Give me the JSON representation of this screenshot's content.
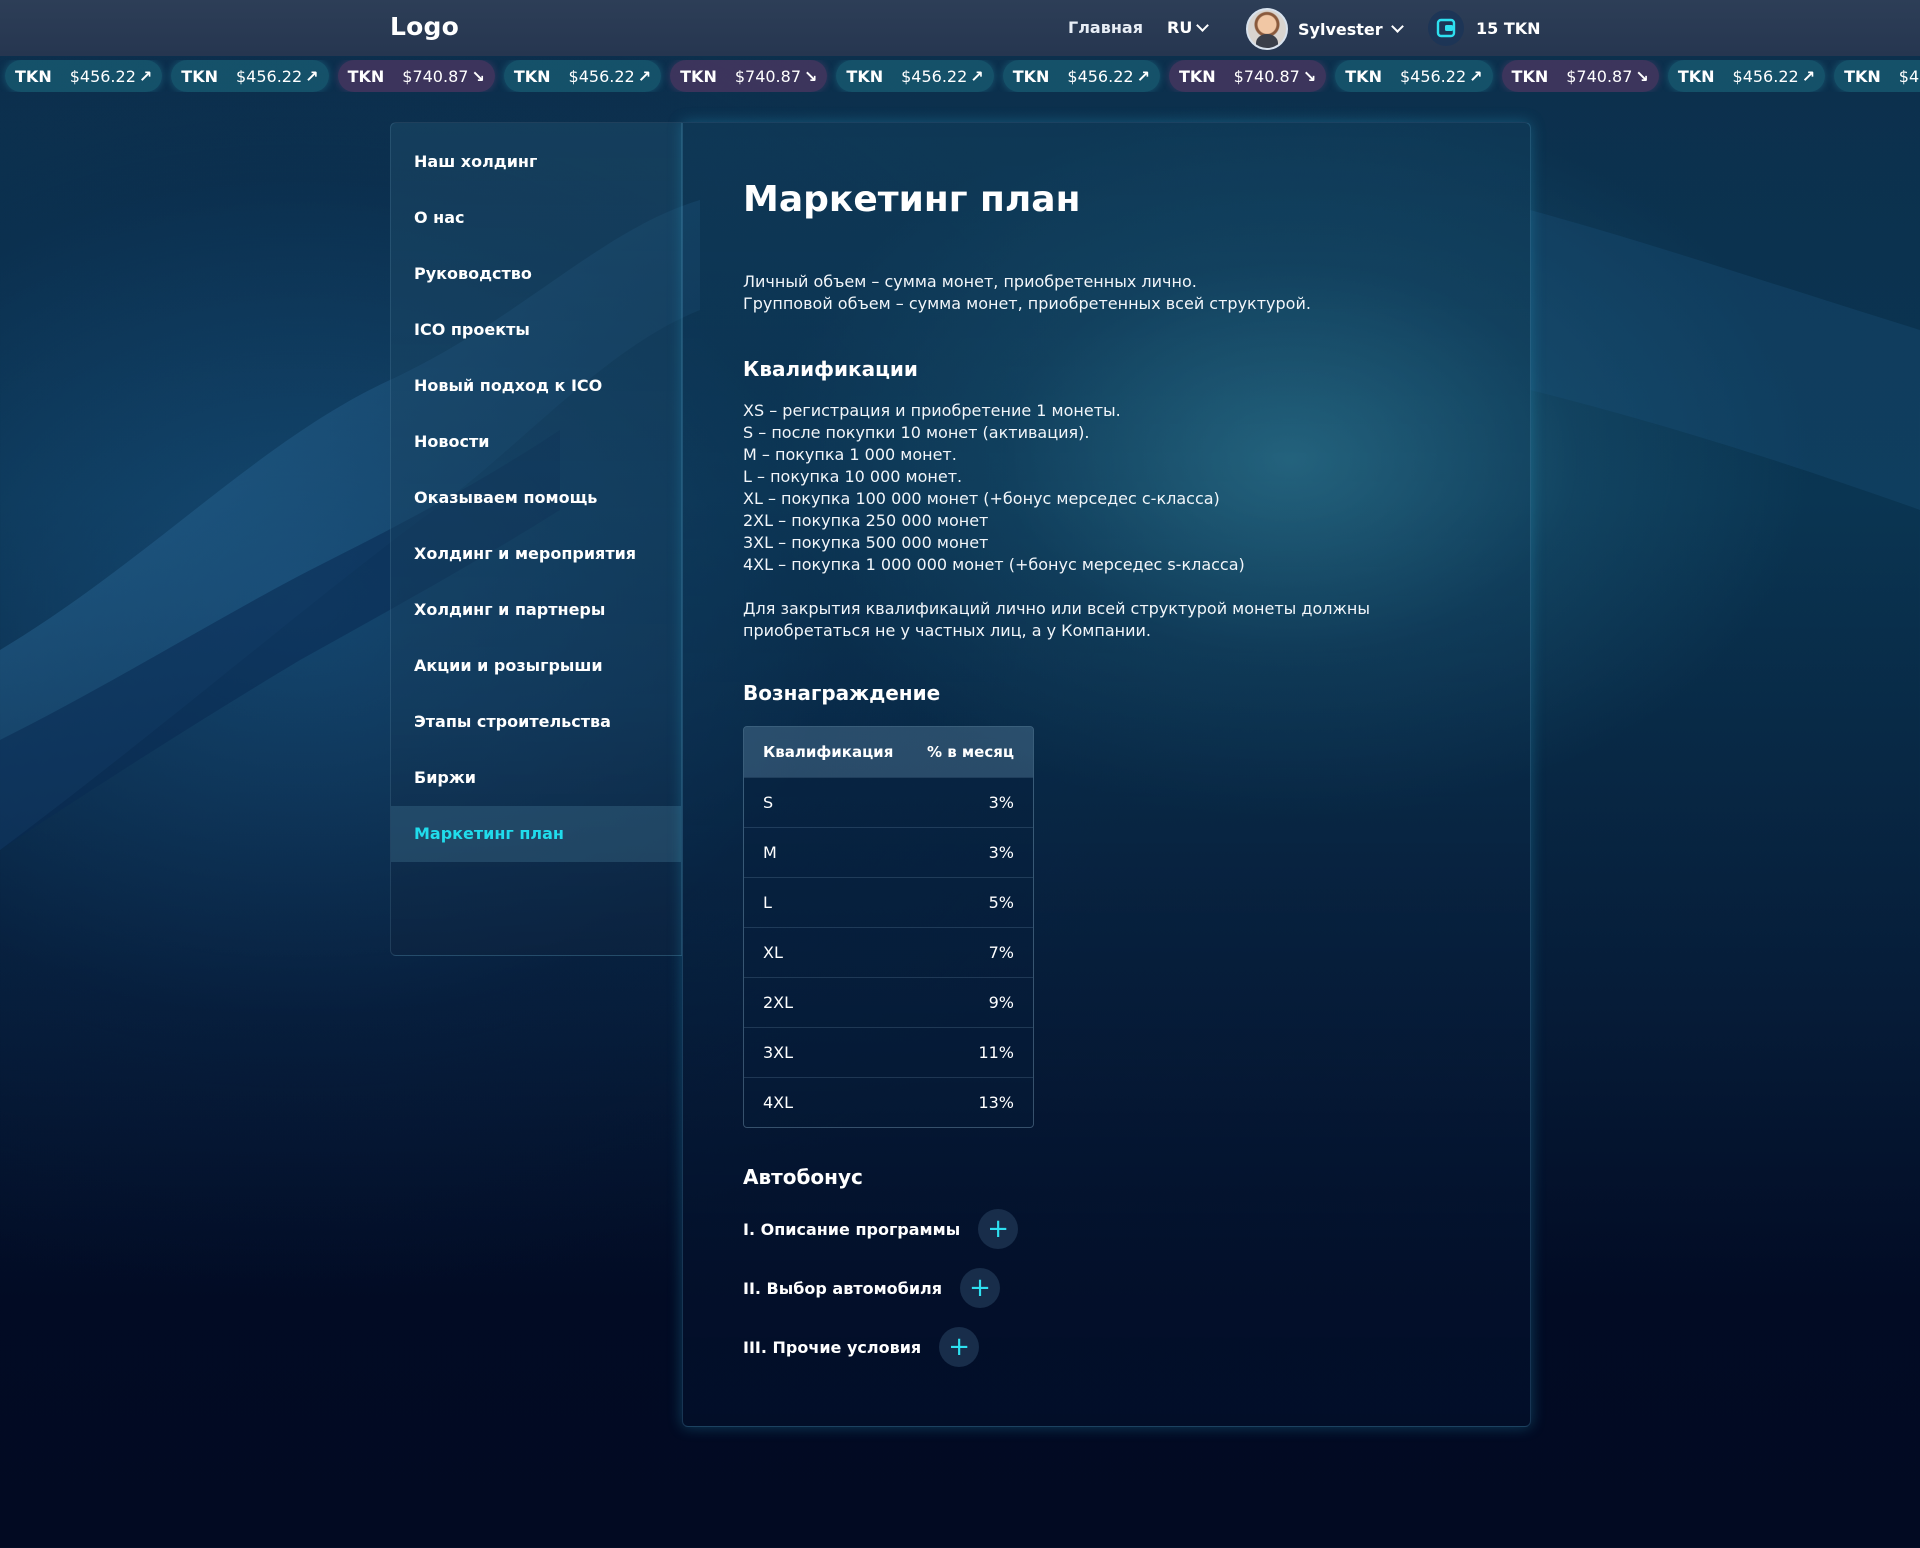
{
  "header": {
    "logo": "Logo",
    "nav_home": "Главная",
    "language": "RU",
    "user_name": "Sylvester",
    "wallet_balance": "15 TKN"
  },
  "ticker": [
    {
      "symbol": "TKN",
      "price": "$456.22",
      "trend": "up"
    },
    {
      "symbol": "TKN",
      "price": "$456.22",
      "trend": "up"
    },
    {
      "symbol": "TKN",
      "price": "$740.87",
      "trend": "down"
    },
    {
      "symbol": "TKN",
      "price": "$456.22",
      "trend": "up"
    },
    {
      "symbol": "TKN",
      "price": "$740.87",
      "trend": "down"
    },
    {
      "symbol": "TKN",
      "price": "$456.22",
      "trend": "up"
    },
    {
      "symbol": "TKN",
      "price": "$456.22",
      "trend": "up"
    },
    {
      "symbol": "TKN",
      "price": "$740.87",
      "trend": "down"
    },
    {
      "symbol": "TKN",
      "price": "$456.22",
      "trend": "up"
    },
    {
      "symbol": "TKN",
      "price": "$740.87",
      "trend": "down"
    },
    {
      "symbol": "TKN",
      "price": "$456.22",
      "trend": "up"
    },
    {
      "symbol": "TKN",
      "price": "$456.22",
      "trend": "up"
    },
    {
      "symbol": "TKN",
      "price": "",
      "trend": "down"
    }
  ],
  "sidebar": {
    "items": [
      {
        "label": "Наш холдинг"
      },
      {
        "label": "О нас"
      },
      {
        "label": "Руководство"
      },
      {
        "label": "ICO проекты"
      },
      {
        "label": "Новый подход к ICO"
      },
      {
        "label": "Новости"
      },
      {
        "label": "Оказываем помощь"
      },
      {
        "label": "Холдинг и мероприятия"
      },
      {
        "label": "Холдинг и партнеры"
      },
      {
        "label": "Акции и розыгрыши"
      },
      {
        "label": "Этапы строительства"
      },
      {
        "label": "Биржи"
      },
      {
        "label": "Маркетинг план",
        "active": true
      }
    ]
  },
  "main": {
    "title": "Маркетинг план",
    "intro": [
      "Личный объем – сумма монет, приобретенных лично.",
      "Групповой объем – сумма монет, приобретенных всей структурой."
    ],
    "qualifications_title": "Квалификации",
    "qualifications": [
      "XS – регистрация и приобретение 1 монеты.",
      "S – после покупки 10 монет (активация).",
      "M – покупка 1 000 монет.",
      "L – покупка 10 000 монет.",
      "XL – покупка 100 000 монет (+бонус мерседес c-класса)",
      "2XL – покупка 250 000 монет",
      "3XL – покупка 500 000 монет",
      "4XL – покупка 1 000 000 монет (+бонус мерседес s-класса)"
    ],
    "closing_note": [
      "Для закрытия квалификаций лично или всей структурой монеты должны",
      "приобретаться не у частных лиц, а у Компании."
    ],
    "reward_title": "Вознаграждение",
    "reward_table": {
      "headers": [
        "Квалификация",
        "% в месяц"
      ],
      "rows": [
        [
          "S",
          "3%"
        ],
        [
          "M",
          "3%"
        ],
        [
          "L",
          "5%"
        ],
        [
          "XL",
          "7%"
        ],
        [
          "2XL",
          "9%"
        ],
        [
          "3XL",
          "11%"
        ],
        [
          "4XL",
          "13%"
        ]
      ]
    },
    "autobonus_title": "Автобонус",
    "accordion": [
      {
        "label": "I. Описание программы"
      },
      {
        "label": "II. Выбор автомобиля"
      },
      {
        "label": "III. Прочие условия"
      }
    ]
  },
  "colors": {
    "accent": "#20dcec",
    "chip_up": "#1e6e82",
    "chip_down": "#783c6e",
    "header_bg": "#2d3e57"
  },
  "icons": {
    "wallet": "wallet-icon",
    "chevron": "chevron-down-icon",
    "plus": "plus-icon",
    "trend_up": "arrow-up-right-icon",
    "trend_down": "arrow-down-right-icon"
  }
}
